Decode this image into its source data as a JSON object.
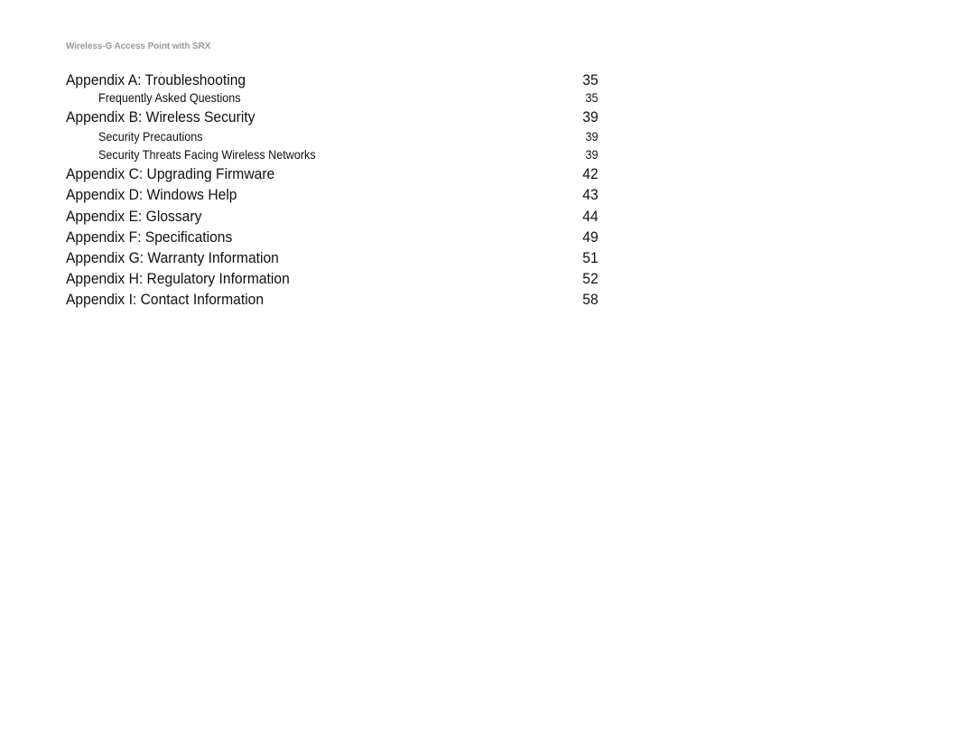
{
  "running_head": "Wireless-G Access Point with SRX",
  "toc": [
    {
      "level": "main",
      "title": "Appendix A: Troubleshooting",
      "page": "35"
    },
    {
      "level": "sub",
      "title": "Frequently Asked Questions",
      "page": "35"
    },
    {
      "level": "main",
      "title": "Appendix B: Wireless Security",
      "page": "39"
    },
    {
      "level": "sub",
      "title": "Security Precautions",
      "page": "39"
    },
    {
      "level": "sub",
      "title": "Security Threats Facing Wireless Networks",
      "page": "39"
    },
    {
      "level": "main",
      "title": "Appendix C: Upgrading Firmware",
      "page": "42"
    },
    {
      "level": "main",
      "title": "Appendix D: Windows Help",
      "page": "43"
    },
    {
      "level": "main",
      "title": "Appendix E: Glossary",
      "page": "44"
    },
    {
      "level": "main",
      "title": "Appendix F: Specifications",
      "page": "49"
    },
    {
      "level": "main",
      "title": "Appendix G: Warranty Information",
      "page": "51"
    },
    {
      "level": "main",
      "title": "Appendix H: Regulatory Information",
      "page": "52"
    },
    {
      "level": "main",
      "title": "Appendix I: Contact Information",
      "page": "58"
    }
  ]
}
